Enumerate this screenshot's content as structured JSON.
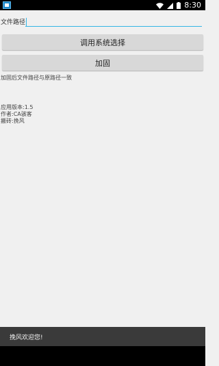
{
  "status_bar": {
    "time": "8:30",
    "icons": [
      "app-icon",
      "wifi-icon",
      "signal-icon",
      "battery-icon"
    ]
  },
  "form": {
    "file_path_label": "文件路径",
    "file_path_value": "",
    "select_button_label": "调用系统选择",
    "harden_button_label": "加固"
  },
  "info": {
    "hint": "加固后文件路径与原路径一致",
    "version": "应用版本:1.5",
    "author": "作者:CA骇客",
    "porter": "搬砖:挽风"
  },
  "toast": {
    "message": "挽风欢迎您!"
  },
  "colors": {
    "accent": "#33b5e5",
    "background": "#f0f0f0",
    "button": "#d8d8d8",
    "toast": "#3a3a3a"
  }
}
